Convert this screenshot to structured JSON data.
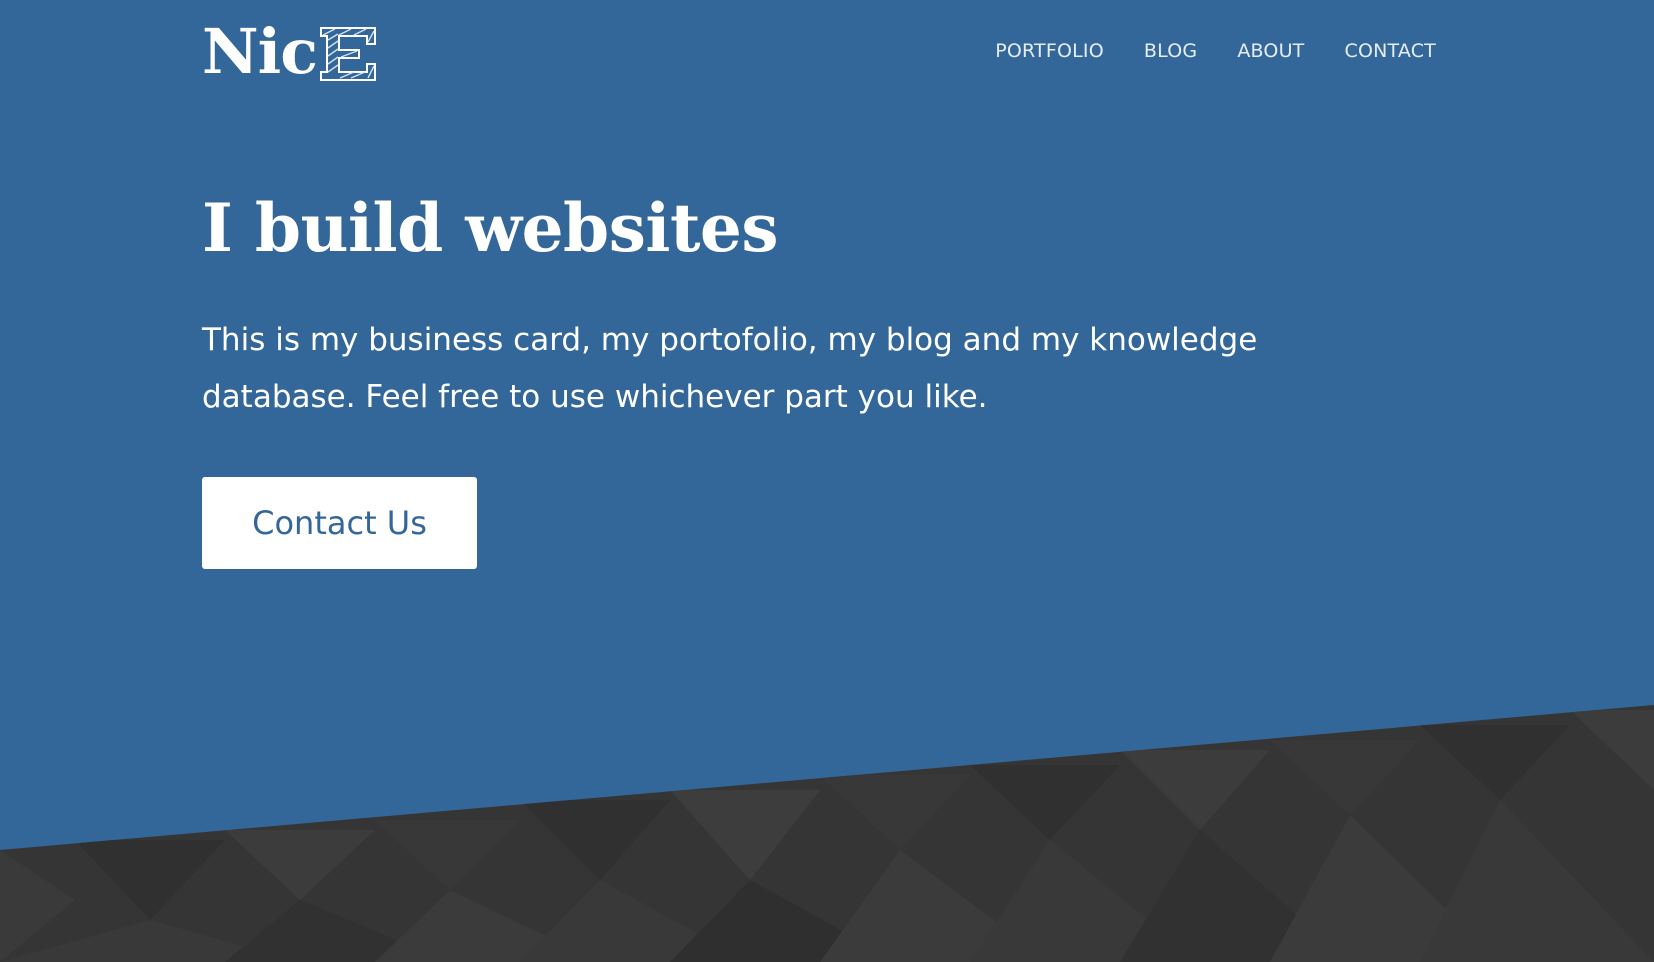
{
  "brand": {
    "logo_main": "Nic",
    "logo_accent": "E"
  },
  "nav": {
    "items": [
      "PORTFOLIO",
      "BLOG",
      "ABOUT",
      "CONTACT"
    ]
  },
  "hero": {
    "headline": "I build websites",
    "intro": "This is my business card, my portofolio, my blog and my knowledge database. Feel free to use whichever part you like.",
    "cta_label": "Contact Us"
  },
  "colors": {
    "hero_background": "#346799",
    "band_background": "#353535",
    "text": "#ffffff",
    "button_text": "#346799"
  }
}
